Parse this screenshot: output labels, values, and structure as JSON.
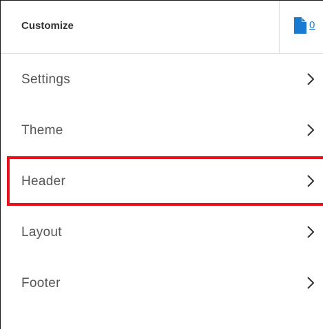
{
  "header": {
    "title": "Customize",
    "document_count": "0",
    "document_icon": "document-icon"
  },
  "menu": {
    "items": [
      {
        "label": "Settings",
        "icon": "chevron-right-icon"
      },
      {
        "label": "Theme",
        "icon": "chevron-right-icon"
      },
      {
        "label": "Header",
        "icon": "chevron-right-icon",
        "highlighted": true
      },
      {
        "label": "Layout",
        "icon": "chevron-right-icon"
      },
      {
        "label": "Footer",
        "icon": "chevron-right-icon"
      }
    ]
  },
  "colors": {
    "link": "#1a7bd3",
    "highlight": "#e8101a",
    "label": "#555555",
    "title": "#333333"
  }
}
